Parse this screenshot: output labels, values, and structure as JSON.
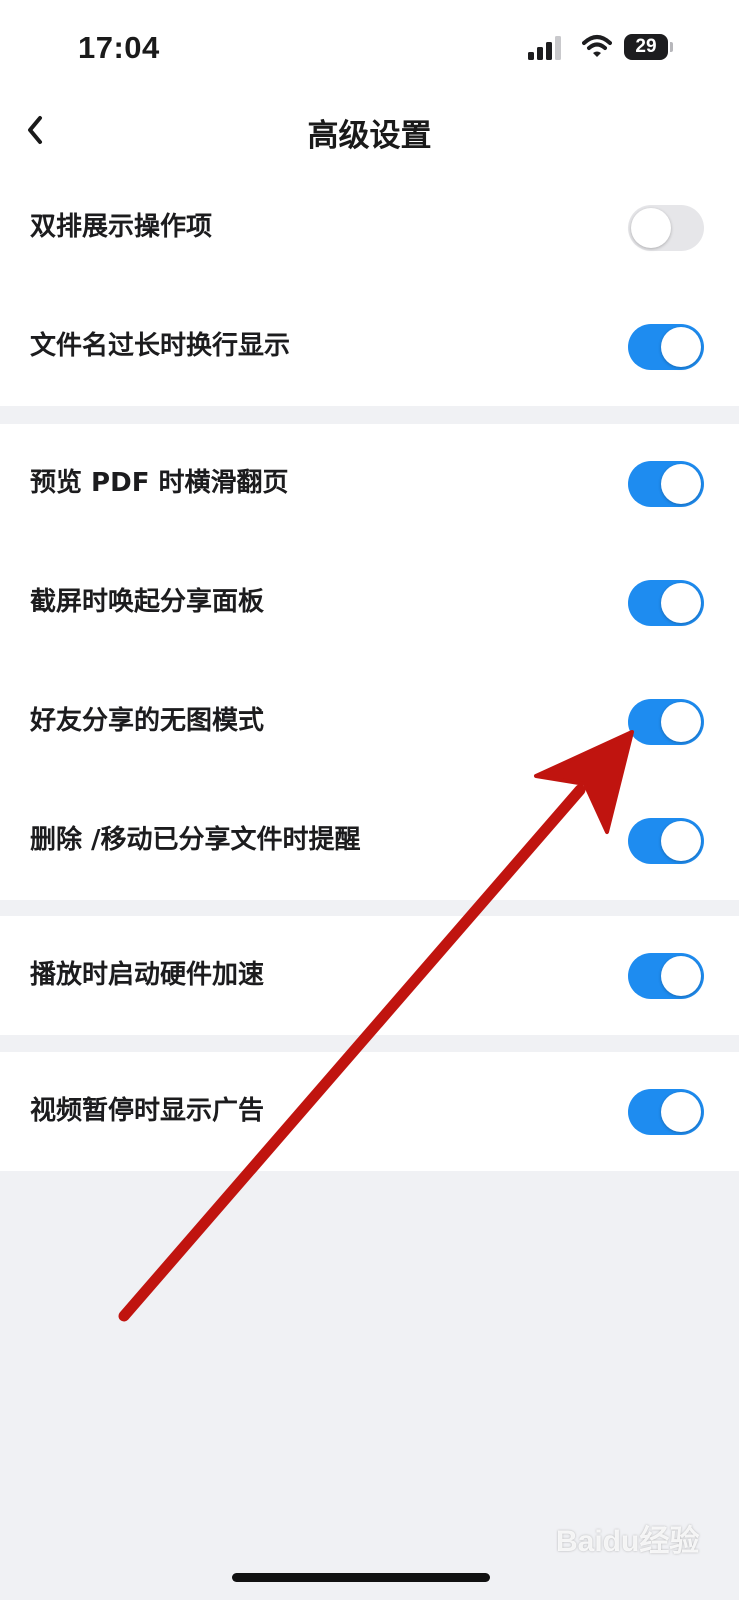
{
  "status_bar": {
    "time": "17:04",
    "battery_level": "29",
    "icons": [
      "signal-icon",
      "wifi-icon",
      "battery-icon"
    ]
  },
  "nav": {
    "title": "高级设置",
    "back_icon": "chevron-left-icon"
  },
  "colors": {
    "toggle_on": "#1e8cf0",
    "toggle_off": "#e6e6e9",
    "arrow": "#c0140f",
    "background": "#f0f1f4"
  },
  "groups": [
    {
      "items": [
        {
          "label": "双排展示操作项",
          "enabled": false
        },
        {
          "label": "文件名过长时换行显示",
          "enabled": true
        }
      ]
    },
    {
      "items": [
        {
          "label": "预览 PDF 时横滑翻页",
          "enabled": true
        },
        {
          "label": "截屏时唤起分享面板",
          "enabled": true
        },
        {
          "label": "好友分享的无图模式",
          "enabled": true
        },
        {
          "label": "删除 /移动已分享文件时提醒",
          "enabled": true
        }
      ]
    },
    {
      "items": [
        {
          "label": "播放时启动硬件加速",
          "enabled": true
        }
      ]
    },
    {
      "items": [
        {
          "label": "视频暂停时显示广告",
          "enabled": true
        }
      ]
    }
  ],
  "watermark": "Baidu经验"
}
